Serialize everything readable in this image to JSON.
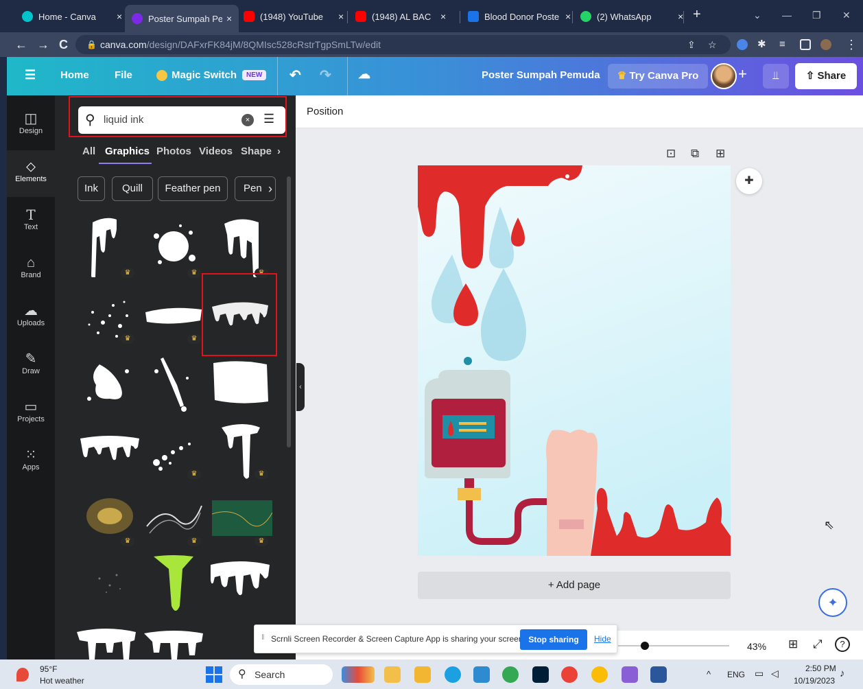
{
  "browser": {
    "tabs": [
      {
        "title": "Home - Canva",
        "close": "×",
        "color": "#00c4cc"
      },
      {
        "title": "Poster Sumpah Pe",
        "close": "×",
        "color": "#7d2ae8"
      },
      {
        "title": "(1948) YouTube",
        "close": "×",
        "color": "#ff0000"
      },
      {
        "title": "(1948) AL BAC",
        "close": "×",
        "color": "#ff0000"
      },
      {
        "title": "Blood Donor Poste",
        "close": "×",
        "color": "#1a73e8"
      },
      {
        "title": "(2) WhatsApp",
        "close": "×",
        "color": "#25d366"
      }
    ],
    "new_tab": "+",
    "url_host": "canva.com",
    "url_path": "/design/DAFxrFK84jM/8QMIsc528cRstrTgpSmLTw/edit"
  },
  "header": {
    "home": "Home",
    "file": "File",
    "magic_switch": "Magic Switch",
    "new_badge": "NEW",
    "design_title": "Poster Sumpah Pemuda",
    "try_pro": "Try Canva Pro",
    "share": "Share",
    "plus": "+"
  },
  "rail": {
    "items": [
      {
        "label": "Design",
        "icon": "▢"
      },
      {
        "label": "Elements",
        "icon": "◇"
      },
      {
        "label": "Text",
        "icon": "T"
      },
      {
        "label": "Brand",
        "icon": "⌂"
      },
      {
        "label": "Uploads",
        "icon": "☁"
      },
      {
        "label": "Draw",
        "icon": "✎"
      },
      {
        "label": "Projects",
        "icon": "▭"
      },
      {
        "label": "Apps",
        "icon": "⋮⋮"
      }
    ]
  },
  "panel": {
    "search_value": "liquid ink",
    "tabs": [
      "All",
      "Graphics",
      "Photos",
      "Videos",
      "Shape"
    ],
    "chips": [
      "Ink",
      "Quill",
      "Feather pen",
      "Pen"
    ]
  },
  "editor": {
    "position_label": "Position",
    "add_page": "+ Add page",
    "zoom": "43%"
  },
  "banner": {
    "message": "Scrnli Screen Recorder & Screen Capture App is sharing your screen.",
    "stop": "Stop sharing",
    "hide": "Hide"
  },
  "taskbar": {
    "temp": "95°F",
    "weather": "Hot weather",
    "search": "Search",
    "lang": "ENG",
    "time": "2:50 PM",
    "date": "10/19/2023"
  },
  "colors": {
    "accent": "#8b7ef0",
    "highlight": "#e0121b",
    "blood": "#e02b2b"
  }
}
